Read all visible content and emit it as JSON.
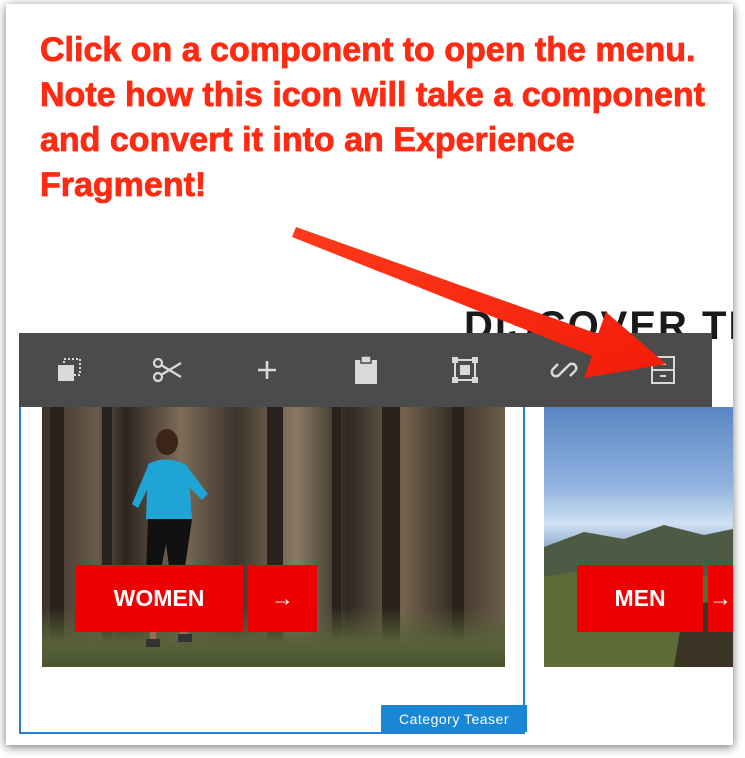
{
  "annotation": {
    "text": "Click on a component to open the menu. Note how this icon will take a component and convert it into an Experience Fragment!",
    "color": "#ff2a12"
  },
  "page": {
    "heading_partial": "DISCOVER TH"
  },
  "toolbar": {
    "background": "#4b4b4b",
    "buttons": [
      {
        "icon": "configure-icon"
      },
      {
        "icon": "scissors-icon"
      },
      {
        "icon": "plus-icon"
      },
      {
        "icon": "clipboard-icon"
      },
      {
        "icon": "group-icon"
      },
      {
        "icon": "link-icon"
      },
      {
        "icon": "experience-fragment-icon"
      }
    ]
  },
  "teasers": {
    "women": {
      "label": "WOMEN",
      "arrow": "→"
    },
    "men": {
      "label": "MEN",
      "arrow": "→"
    }
  },
  "component_label": "Category Teaser",
  "colors": {
    "cta": "#ee0000",
    "selection_border": "#2a7fd4",
    "label_bg": "#1a87d6"
  }
}
